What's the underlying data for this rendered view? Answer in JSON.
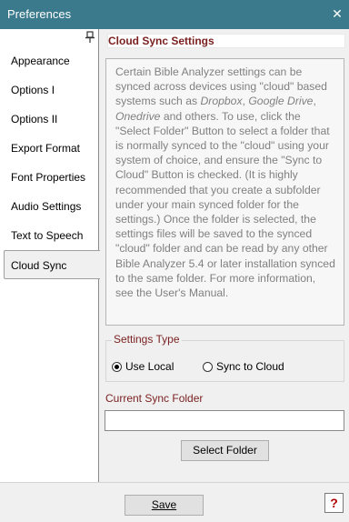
{
  "window": {
    "title": "Preferences",
    "close_glyph": "✕"
  },
  "sidebar": {
    "pin_icon": "pin-icon",
    "items": [
      {
        "label": "Appearance"
      },
      {
        "label": "Options I"
      },
      {
        "label": "Options II"
      },
      {
        "label": "Export Format"
      },
      {
        "label": "Font Properties"
      },
      {
        "label": "Audio Settings"
      },
      {
        "label": "Text to Speech"
      },
      {
        "label": "Cloud Sync",
        "active": true
      }
    ]
  },
  "panel": {
    "title": "Cloud Sync Settings",
    "description": {
      "part1": "Certain Bible Analyzer settings can be synced across devices using \"cloud\" based systems such as ",
      "em1": "Dropbox",
      "sep1": ", ",
      "em2": "Google Drive",
      "sep2": ", ",
      "em3": "Onedrive",
      "part2": " and others. To use, click the \"Select Folder\" Button to select a folder that is normally synced to the \"cloud\" using your system of choice, and ensure the \"Sync to Cloud\" Button is checked. (It is highly recommended that you create a subfolder under your main synced folder for the settings.) Once the folder is selected, the settings files will be saved to the synced \"cloud\" folder and can be read by any other Bible Analyzer 5.4 or later installation synced to the same folder. For more information, see the User's Manual."
    },
    "settings_type": {
      "legend": "Settings Type",
      "options": [
        {
          "label": "Use Local",
          "selected": true
        },
        {
          "label": "Sync to Cloud",
          "selected": false
        }
      ]
    },
    "current_sync_folder": {
      "label": "Current Sync Folder",
      "value": ""
    },
    "select_folder_label": "Select Folder"
  },
  "footer": {
    "save_label": "Save",
    "help_label": "?"
  },
  "colors": {
    "titlebar": "#3a7a8c",
    "section_text": "#7a1f1f",
    "help": "#b00000"
  }
}
